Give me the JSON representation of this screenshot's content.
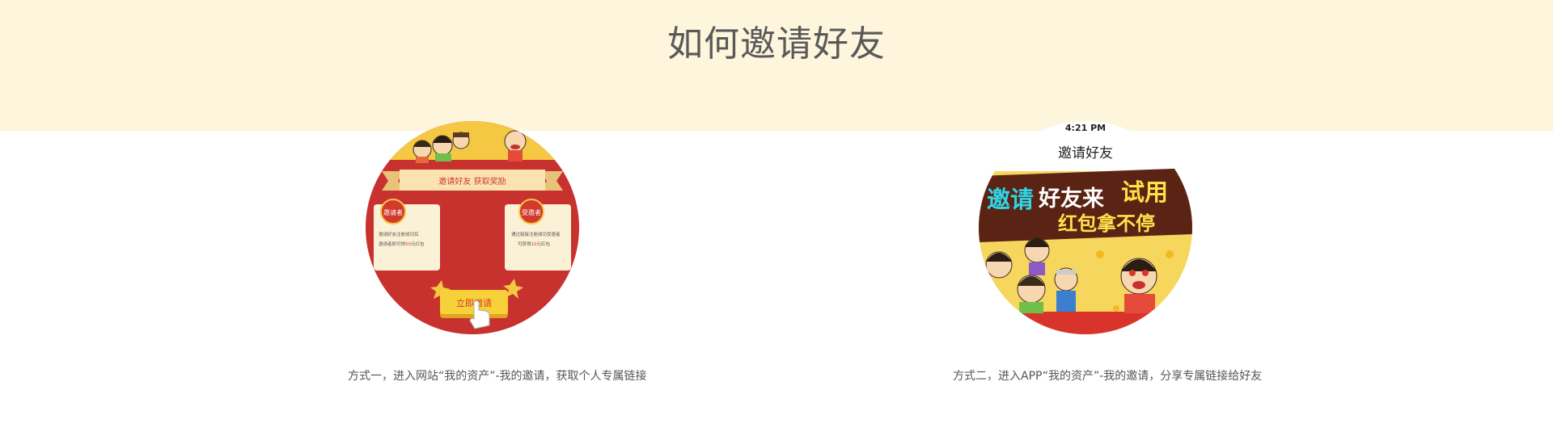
{
  "page": {
    "title": "如何邀请好友"
  },
  "methods": [
    {
      "banner_text": "邀请好友 获取奖励",
      "left_card": {
        "badge": "邀请者",
        "line1": "邀请好友注册成功后",
        "line2_prefix": "邀请者即可得",
        "highlight": "50",
        "line2_suffix": "元红包"
      },
      "right_card": {
        "badge": "受邀者",
        "line1": "通过链接注册成功受邀者",
        "line2_prefix": "可获得",
        "highlight": "10",
        "line2_suffix": "元红包"
      },
      "button_label": "立即邀请",
      "caption": "方式一，进入网站“我的资产”-我的邀请，获取个人专属链接"
    },
    {
      "status_time": "4:21 PM",
      "screen_title": "邀请好友",
      "promo_line1_a": "邀请",
      "promo_line1_b": "好友来",
      "promo_line1_c": "试用",
      "promo_line2": "红包拿不停",
      "caption": "方式二，进入APP“我的资产”-我的邀请，分享专属链接给好友"
    }
  ],
  "colors": {
    "band": "#fdf5dc",
    "red": "#c8322e",
    "gold": "#f4c842",
    "cream": "#fbf1d6"
  }
}
